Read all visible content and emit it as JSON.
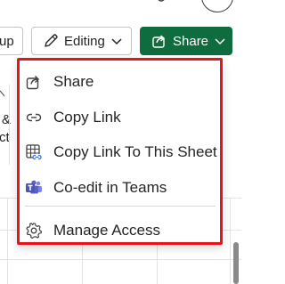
{
  "toolbar": {
    "left_button_label": "up",
    "editing_label": "Editing",
    "share_label": "Share"
  },
  "ribbon_fragments": [
    "&",
    "ct"
  ],
  "menu": {
    "items": [
      {
        "label": "Share",
        "icon": "share-icon"
      },
      {
        "label": "Copy Link",
        "icon": "link-icon"
      },
      {
        "label": "Copy Link To This Sheet",
        "icon": "sheet-link-icon"
      },
      {
        "label": "Co-edit in Teams",
        "icon": "teams-icon"
      },
      {
        "label": "Manage Access",
        "icon": "gear-icon"
      }
    ]
  },
  "colors": {
    "share_button_bg": "#0f6c3e",
    "highlight_border": "#e8141b",
    "teams_purple": "#5b5fc7"
  }
}
